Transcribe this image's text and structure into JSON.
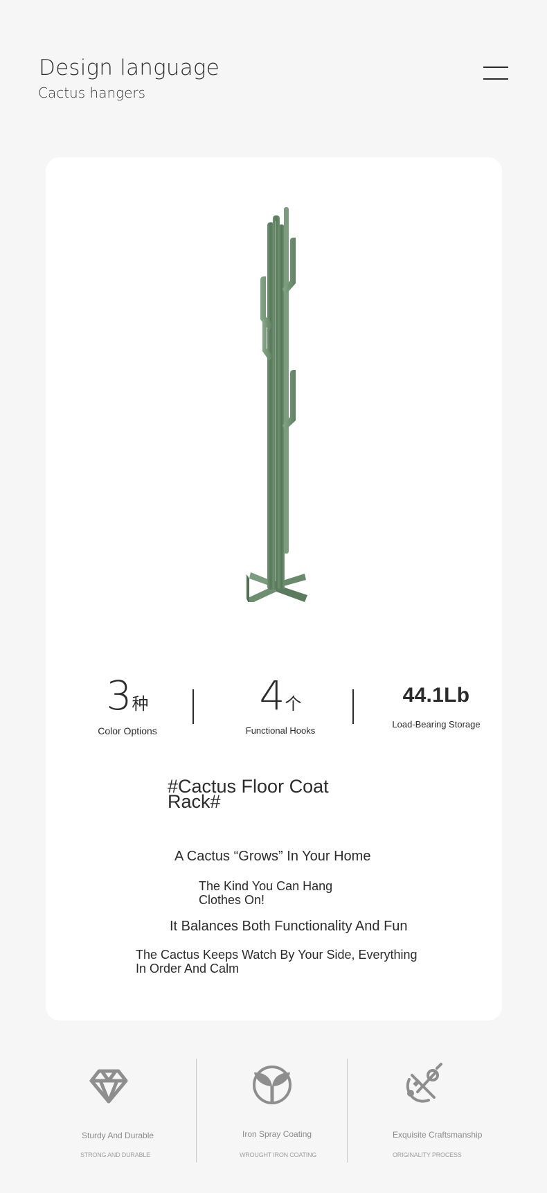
{
  "header": {
    "title": "Design language",
    "subtitle": "Cactus hangers"
  },
  "menu": {
    "icon": "menu-icon"
  },
  "product": {
    "image_icon": "cactus-coat-rack-image",
    "color": "#5e7f60"
  },
  "stats": [
    {
      "value": "3",
      "unit": "种",
      "label": "Color Options"
    },
    {
      "value": "4",
      "unit": "个",
      "label": "Functional Hooks"
    },
    {
      "value": "44.1Lb",
      "unit": "",
      "label": "Load-Bearing Storage"
    }
  ],
  "copy": {
    "hashtag": "#Cactus Floor Coat Rack#",
    "line1": "A Cactus “Grows” In Your Home",
    "line2": "The Kind You Can Hang Clothes On!",
    "line3": "It Balances Both Functionality And Fun",
    "line4": "The Cactus Keeps Watch By Your Side, Everything In Order And Calm"
  },
  "features": [
    {
      "icon": "diamond-icon",
      "title": "Sturdy And Durable",
      "subtitle": "STRONG AND DURABLE"
    },
    {
      "icon": "sprout-icon",
      "title": "Iron Spray Coating",
      "subtitle": "WROUGHT IRON COATING"
    },
    {
      "icon": "craft-tools-icon",
      "title": "Exquisite Craftsmanship",
      "subtitle": "ORIGINALITY PROCESS"
    }
  ],
  "colors": {
    "background": "#f6f6f6",
    "card": "#ffffff",
    "text": "#2b2b2b",
    "feature_icon": "#8e8e8e"
  }
}
